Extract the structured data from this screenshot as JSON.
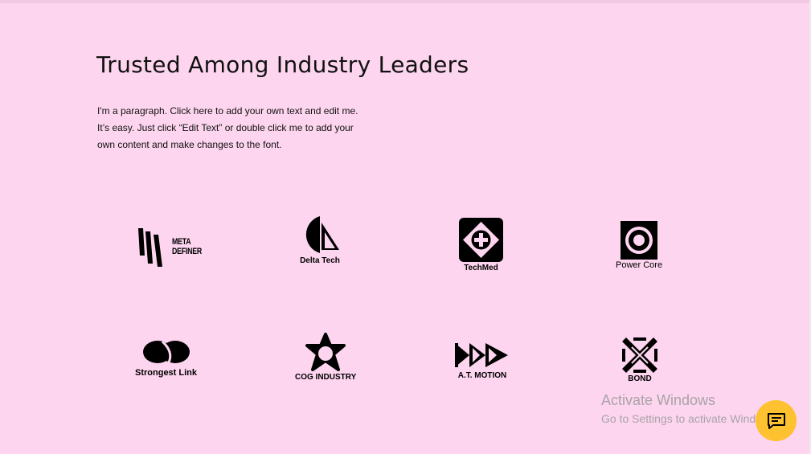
{
  "section": {
    "title": "Trusted Among Industry Leaders",
    "paragraph_lines": [
      "I'm a paragraph. Click here to add your own text and edit me.",
      "It’s easy. Just click “Edit Text” or double click me to add your",
      "own content and make changes to the font."
    ]
  },
  "logos": {
    "meta_definer": {
      "line1": "META",
      "line2": "DEFINER",
      "icon": "meta-definer-logo-icon"
    },
    "delta_tech": {
      "label": "Delta Tech",
      "icon": "delta-tech-logo-icon"
    },
    "techmed": {
      "label": "TechMed",
      "icon": "plus-diamond-icon"
    },
    "power_core": {
      "label": "Power Core",
      "icon": "power-core-logo-icon"
    },
    "strongest_link": {
      "label": "Strongest Link",
      "icon": "link-loops-icon"
    },
    "cog_industry": {
      "label": "COG INDUSTRY",
      "icon": "cog-star-icon"
    },
    "at_motion": {
      "label": "A.T. MOTION",
      "icon": "triple-arrow-icon"
    },
    "bond": {
      "label": "BOND",
      "icon": "lattice-x-icon"
    }
  },
  "watermark": {
    "title": "Activate Windows",
    "subtitle": "Go to Settings to activate Windows."
  },
  "chat_button": {
    "icon": "chat-icon",
    "color": "#fec12f"
  },
  "colors": {
    "background": "#fdd5ef",
    "text": "#000000"
  }
}
